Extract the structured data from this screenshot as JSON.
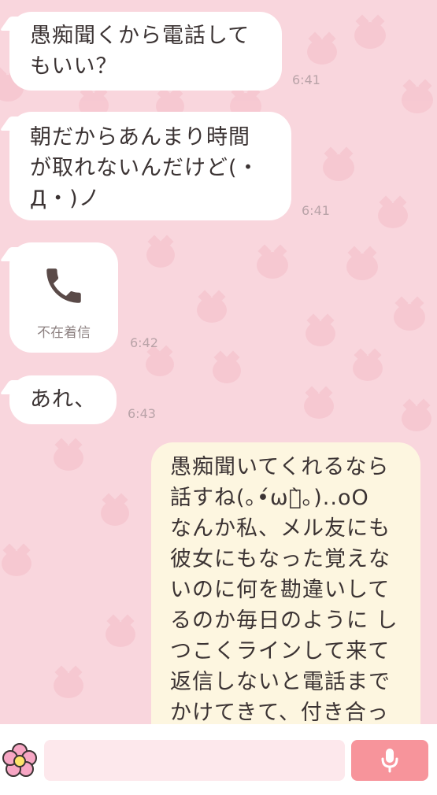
{
  "messages": [
    {
      "id": "m1",
      "direction": "incoming",
      "text": "愚痴聞くから電話して\nもいい？",
      "time": "6:41"
    },
    {
      "id": "m2",
      "direction": "incoming",
      "text": "朝だからあんまり時間\nが取れないんだけど(・\nД・)ノ",
      "time": "6:41"
    },
    {
      "id": "m3",
      "direction": "incoming",
      "type": "call",
      "call_label": "不在着信",
      "time": "6:42"
    },
    {
      "id": "m4",
      "direction": "incoming",
      "text": "あれ、",
      "time": "6:43"
    },
    {
      "id": "m5",
      "direction": "outgoing",
      "text": "愚痴聞いてくれるなら\n話すね(｡•́ωก̀｡)..oO\nなんか私、メル友にも\n彼女にもなった覚えな\nいのに何を勘違いして\nるのか毎日のように し\nつこくラインして来て\n返信しないと電話まで\nかけてきて、付き合っ"
    }
  ],
  "input_bar": {
    "placeholder": "",
    "left_icon": "flower-icon",
    "right_icon": "microphone-icon"
  },
  "colors": {
    "background": "#f9d6dd",
    "incoming_bubble": "#ffffff",
    "outgoing_bubble": "#fdf6e0",
    "mic_button": "#f7949b",
    "input_field": "#fde8ec",
    "timestamp": "#b9a3a8"
  }
}
